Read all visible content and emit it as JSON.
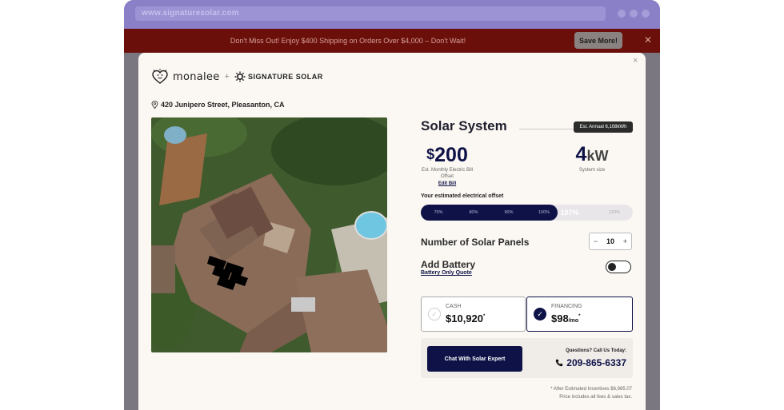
{
  "browser": {
    "url": "www.signaturesolar.com"
  },
  "promo": {
    "text": "Don't Miss Out! Enjoy $400 Shipping on Orders Over $4,000 – Don't Wait!",
    "button": "Save More!",
    "close": "✕"
  },
  "modal": {
    "close": "×"
  },
  "brand": {
    "partner": "monalee",
    "plus": "+",
    "company": "SIGNATURE SOLAR"
  },
  "address": "420 Junipero Street, Pleasanton, CA",
  "system": {
    "title": "Solar System",
    "annual_badge": "Est. Annual 6,108kWh",
    "bill_currency": "$",
    "bill_value": "200",
    "bill_caption": "Est. Monthly Electric Bill Offset",
    "edit_bill": "Edit Bill",
    "kw_value": "4",
    "kw_unit": "kW",
    "kw_caption": "System size"
  },
  "offset": {
    "label": "Your estimated electrical offset",
    "selected_percent": 107,
    "ticks": [
      "70%",
      "80%",
      "90%",
      "100%",
      "107%",
      "120%"
    ]
  },
  "panels": {
    "label": "Number of Solar Panels",
    "value": "10",
    "minus": "−",
    "plus": "+"
  },
  "battery": {
    "label": "Add Battery",
    "link": "Battery Only Quote",
    "enabled": false
  },
  "payment": {
    "cash_label": "CASH",
    "cash_price": "$10,920",
    "cash_asterisk": "*",
    "financing_label": "FINANCING",
    "financing_price": "$98",
    "financing_suffix": "/mo",
    "financing_asterisk": "*",
    "selected": "financing"
  },
  "cta": {
    "chat_button": "Chat With Solar Expert",
    "call_label": "Questions? Call Us Today:",
    "phone": "209-865-6337"
  },
  "footnotes": {
    "incentives": "* After Estimated Incentives $6,985.07",
    "fees": "Price includes all fees & sales tax."
  },
  "colors": {
    "navy": "#0e1247",
    "promo_bg": "#6a0f0a",
    "browser_chrome": "#8a80c8"
  }
}
